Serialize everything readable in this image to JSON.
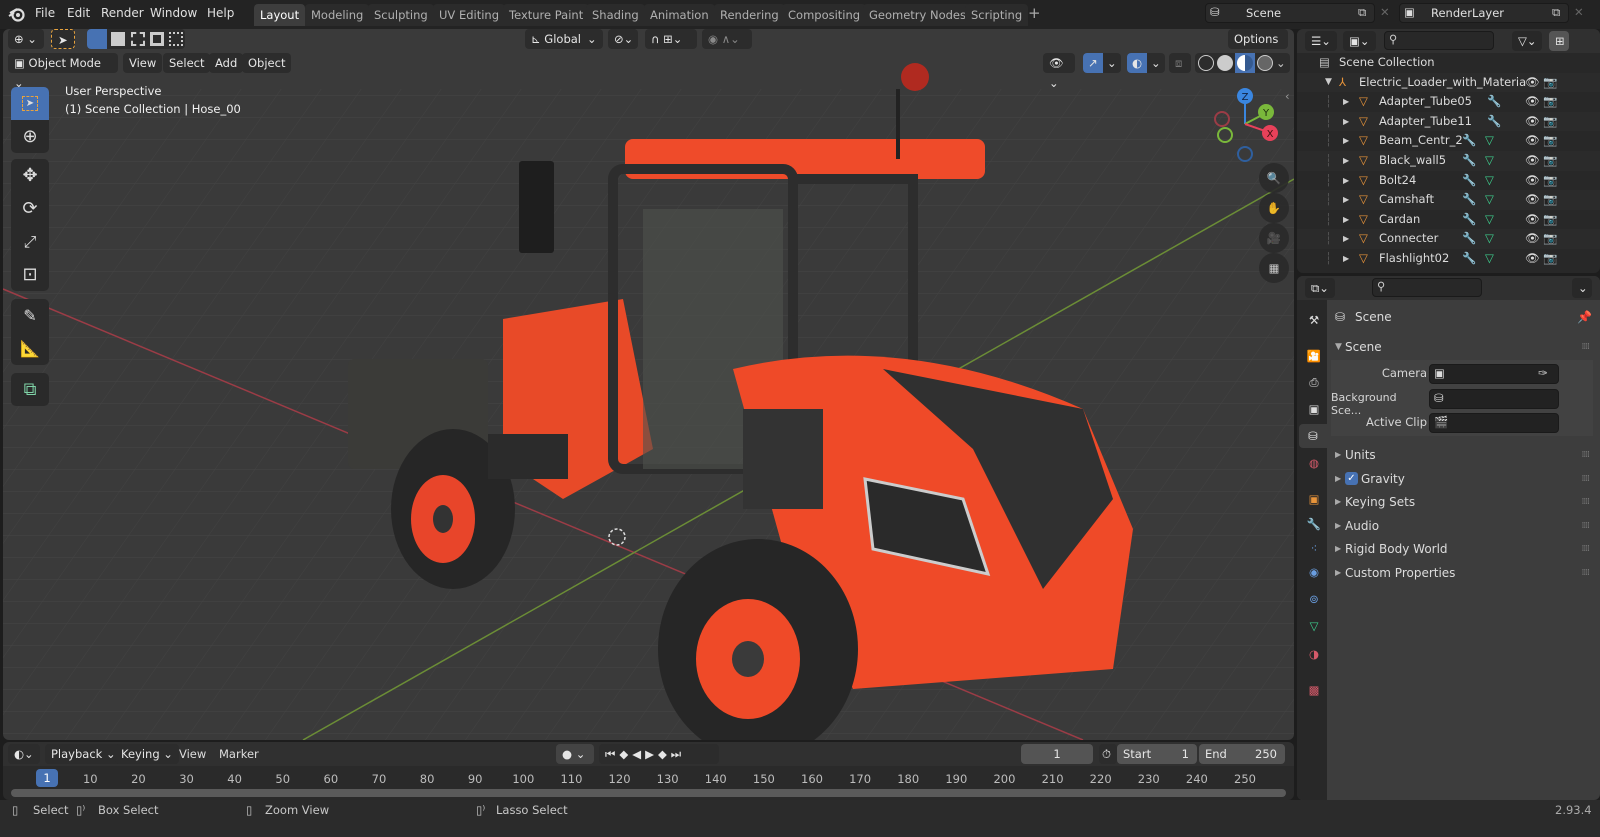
{
  "menubar": {
    "items": [
      "File",
      "Edit",
      "Render",
      "Window",
      "Help"
    ],
    "workspaces": [
      "Layout",
      "Modeling",
      "Sculpting",
      "UV Editing",
      "Texture Paint",
      "Shading",
      "Animation",
      "Rendering",
      "Compositing",
      "Geometry Nodes",
      "Scripting"
    ],
    "active_workspace": "Layout",
    "add_workspace": "+",
    "scene_name": "Scene",
    "view_layer_name": "RenderLayer"
  },
  "viewport": {
    "transform_orientation": "Global",
    "options_label": "Options",
    "mode": "Object Mode",
    "header_menus": [
      "View",
      "Select",
      "Add",
      "Object"
    ],
    "overlay_title": "User Perspective",
    "overlay_subtitle": "(1) Scene Collection | Hose_00",
    "gizmo_axes": {
      "x": "X",
      "y": "Y",
      "z": "Z"
    },
    "colors": {
      "x_axis": "#e8415a",
      "y_axis": "#7ab83b",
      "z_axis": "#3a86e0",
      "object_body": "#f04a26"
    }
  },
  "outliner": {
    "root": "Scene Collection",
    "collection": "Electric_Loader_with_Materia",
    "objects": [
      {
        "name": "Adapter_Tube05",
        "mesh": false
      },
      {
        "name": "Adapter_Tube11",
        "mesh": false
      },
      {
        "name": "Beam_Centr_2",
        "mesh": true
      },
      {
        "name": "Black_wall5",
        "mesh": true
      },
      {
        "name": "Bolt24",
        "mesh": true
      },
      {
        "name": "Camshaft",
        "mesh": true
      },
      {
        "name": "Cardan",
        "mesh": true
      },
      {
        "name": "Connecter",
        "mesh": true
      },
      {
        "name": "Flashlight02",
        "mesh": true
      }
    ]
  },
  "properties": {
    "context_title": "Scene",
    "panel_title": "Scene",
    "fields": [
      {
        "label": "Camera",
        "value": ""
      },
      {
        "label": "Background Sce...",
        "value": ""
      },
      {
        "label": "Active Clip",
        "value": ""
      }
    ],
    "subpanels": [
      {
        "label": "Units",
        "checkbox": false
      },
      {
        "label": "Gravity",
        "checkbox": true,
        "checked": true
      },
      {
        "label": "Keying Sets",
        "checkbox": false
      },
      {
        "label": "Audio",
        "checkbox": false
      },
      {
        "label": "Rigid Body World",
        "checkbox": false
      },
      {
        "label": "Custom Properties",
        "checkbox": false
      }
    ]
  },
  "timeline": {
    "menus": [
      "Playback",
      "Keying",
      "View",
      "Marker"
    ],
    "current_frame": "1",
    "start_label": "Start",
    "start": "1",
    "end_label": "End",
    "end": "250",
    "ticks": [
      "10",
      "20",
      "30",
      "40",
      "50",
      "60",
      "70",
      "80",
      "90",
      "100",
      "110",
      "120",
      "130",
      "140",
      "150",
      "160",
      "170",
      "180",
      "190",
      "200",
      "210",
      "220",
      "230",
      "240",
      "250"
    ],
    "playhead_label": "1"
  },
  "statusbar": {
    "select": "Select",
    "box_select": "Box Select",
    "zoom_view": "Zoom View",
    "lasso_select": "Lasso Select",
    "version": "2.93.4"
  }
}
